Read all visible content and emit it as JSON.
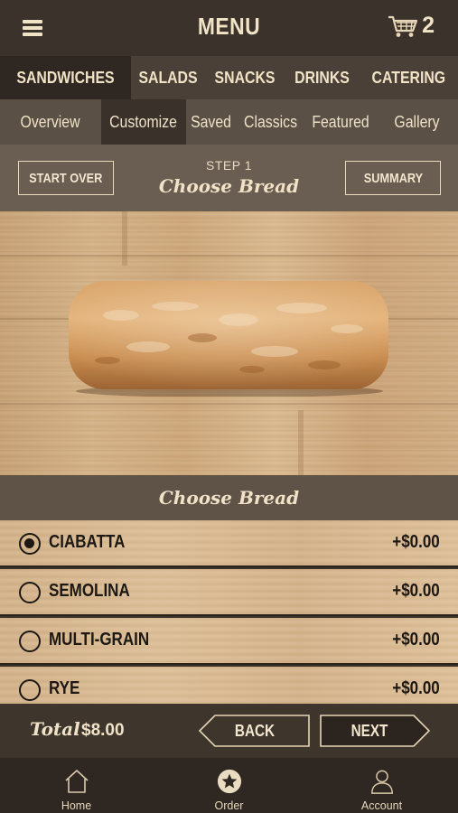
{
  "header": {
    "menu_icon": "hamburger-icon",
    "title": "MENU",
    "cart_icon": "cart-icon",
    "cart_count": "2"
  },
  "categories": [
    {
      "label": "SANDWICHES",
      "active": true
    },
    {
      "label": "SALADS",
      "active": false
    },
    {
      "label": "SNACKS",
      "active": false
    },
    {
      "label": "DRINKS",
      "active": false
    },
    {
      "label": "CATERING",
      "active": false
    }
  ],
  "subtabs": [
    {
      "label": "Overview",
      "active": false
    },
    {
      "label": "Customize",
      "active": true
    },
    {
      "label": "Saved",
      "active": false
    },
    {
      "label": "Classics",
      "active": false
    },
    {
      "label": "Featured",
      "active": false
    },
    {
      "label": "Gallery",
      "active": false
    }
  ],
  "step": {
    "start_over": "START OVER",
    "label": "STEP 1",
    "name": "Choose Bread",
    "summary": "SUMMARY"
  },
  "section_title": "Choose Bread",
  "options": [
    {
      "name": "CIABATTA",
      "price": "+$0.00",
      "selected": true
    },
    {
      "name": "SEMOLINA",
      "price": "+$0.00",
      "selected": false
    },
    {
      "name": "MULTI-GRAIN",
      "price": "+$0.00",
      "selected": false
    },
    {
      "name": "RYE",
      "price": "+$0.00",
      "selected": false
    }
  ],
  "footer": {
    "total_label": "Total",
    "total_value": "$8.00",
    "back": "BACK",
    "next": "NEXT"
  },
  "tabbar": [
    {
      "label": "Home",
      "icon": "home-icon"
    },
    {
      "label": "Order",
      "icon": "star-badge-icon"
    },
    {
      "label": "Account",
      "icon": "person-icon"
    }
  ],
  "colors": {
    "header_bg": "#3b332b",
    "accent_text": "#f1e3c6",
    "wood": "#d6b489",
    "dark_text": "#1d1813"
  }
}
